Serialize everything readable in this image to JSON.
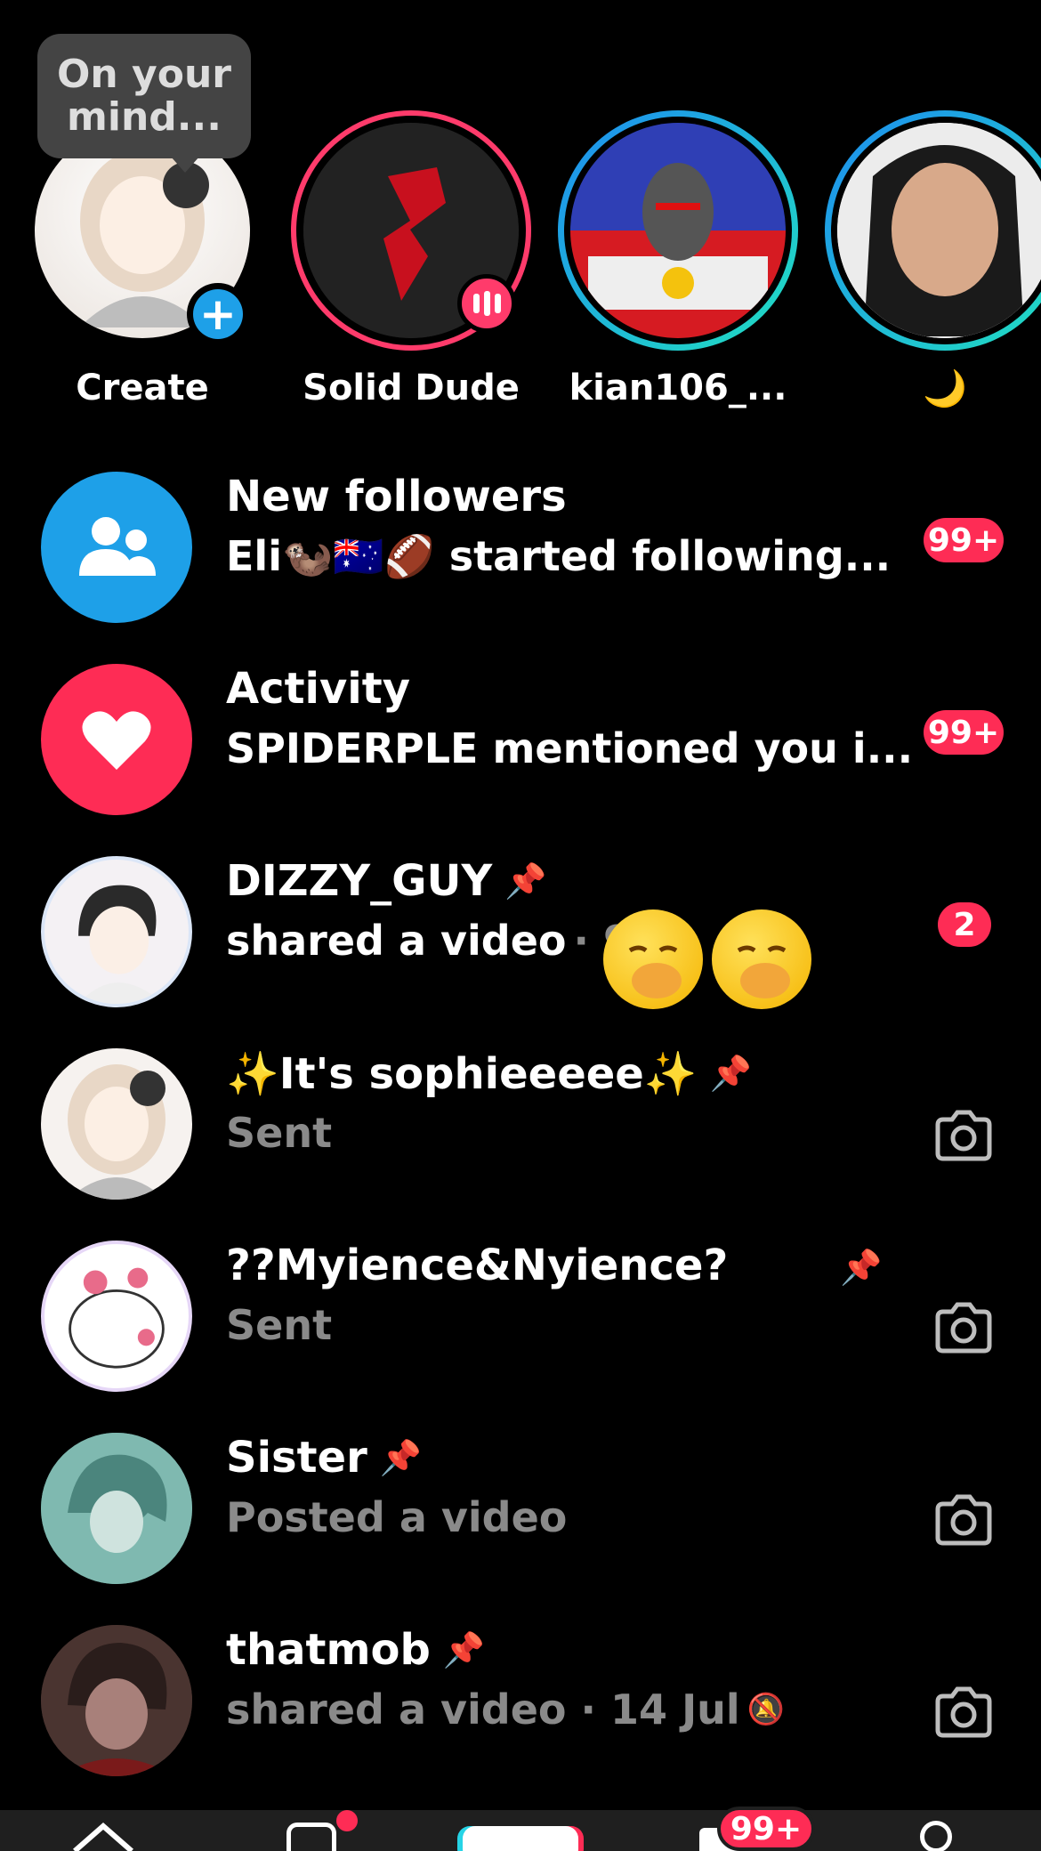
{
  "stories": {
    "tooltip": "On your\nmind...",
    "items": [
      {
        "label": "Create"
      },
      {
        "label": "Solid Dude"
      },
      {
        "label": "kian106_..."
      },
      {
        "label": "🌙"
      }
    ]
  },
  "rows": [
    {
      "title": "New followers",
      "subtitle": "Eli🦦🇦🇺🏈 started following...",
      "badge": "99+"
    },
    {
      "title": "Activity",
      "subtitle": "SPIDERPLE mentioned you i...",
      "badge": "99+"
    },
    {
      "title": "DIZZY_GUY",
      "subtitle": "shared a video",
      "time": "· 9h",
      "badge": "2"
    },
    {
      "title": "✨It's sophieeeee✨",
      "subtitle": "Sent"
    },
    {
      "title": "??Myience&Nyience?",
      "subtitle": "Sent"
    },
    {
      "title": "Sister",
      "subtitle": "Posted a video"
    },
    {
      "title": "thatmob",
      "subtitle": "shared a video · 14 Jul"
    }
  ],
  "nav": {
    "inbox_badge": "99+"
  },
  "colors": {
    "accent_red": "#fe2c55",
    "accent_blue": "#1ea0e8",
    "live_pink": "#ff3b6b"
  }
}
